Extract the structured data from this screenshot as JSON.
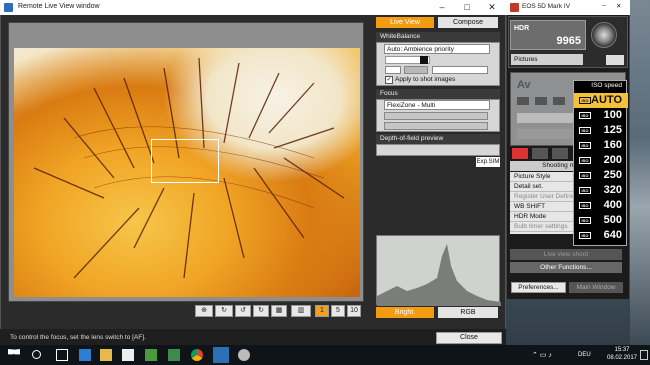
{
  "liveview": {
    "title": "Remote Live View window",
    "tabs": {
      "live_view": "Live View",
      "compose": "Compose"
    },
    "white_balance": {
      "header": "WhiteBalance",
      "mode": "Auto: Ambience priority",
      "apply_label": "Apply to shot images"
    },
    "focus": {
      "header": "Focus",
      "mode": "FlexiZone - Multi"
    },
    "dof": {
      "header": "Depth-of-field preview",
      "exp_sim": "Exp.SIM"
    },
    "histogram": {
      "bright": "Bright.",
      "rgb": "RGB"
    },
    "status": "To control the focus, set the lens switch to [AF].",
    "close": "Close"
  },
  "camera": {
    "title": "EOS 5D Mark IV",
    "lcd": {
      "mode": "HDR",
      "shots": "9965"
    },
    "pictures": "Pictures",
    "av": "Av",
    "shooting_tab": "Shooting m",
    "menu": [
      "Picture Style",
      "Detail set.",
      "Register User Defined",
      "WB SHIFT",
      "HDR Mode",
      "Bulb timer settings"
    ],
    "live_view_shoot": "Live view shoot",
    "other_functions": "Other Functions...",
    "preferences": "Preferences...",
    "main_window": "Main Window",
    "iso": {
      "header": "ISO speed",
      "values": [
        "AUTO",
        "100",
        "125",
        "160",
        "200",
        "250",
        "320",
        "400",
        "500",
        "640"
      ],
      "selected": "AUTO"
    }
  },
  "taskbar": {
    "time": "15:37",
    "date": "08.02.2017",
    "lang": "DEU"
  }
}
